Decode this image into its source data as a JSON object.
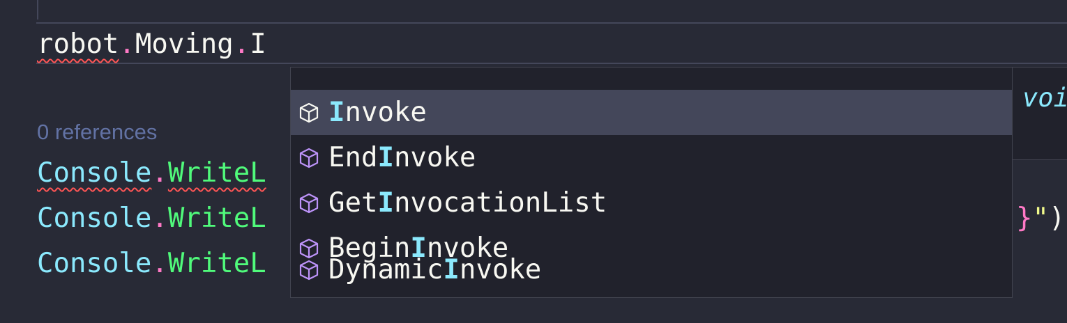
{
  "editor": {
    "active_line": {
      "segments": [
        "robot",
        ".",
        "Moving",
        ".",
        "I"
      ]
    },
    "codelens": "0 references",
    "lines": [
      {
        "object": "Console",
        "dot": ".",
        "method": "WriteL"
      },
      {
        "object": "Console",
        "dot": ".",
        "method": "WriteL"
      },
      {
        "object": "Console",
        "dot": ".",
        "method": "WriteL"
      }
    ],
    "right_tail": {
      "brace": "}",
      "quote": "\"",
      "paren": ")"
    }
  },
  "suggest_widget": {
    "items": [
      {
        "prefix": "",
        "match": "I",
        "suffix": "nvoke",
        "icon": "method-cube-icon",
        "selected": true
      },
      {
        "prefix": "End",
        "match": "I",
        "suffix": "nvoke",
        "icon": "method-cube-icon",
        "selected": false
      },
      {
        "prefix": "Get",
        "match": "I",
        "suffix": "nvocationList",
        "icon": "method-cube-icon",
        "selected": false
      },
      {
        "prefix": "Begin",
        "match": "I",
        "suffix": "nvoke",
        "icon": "method-cube-icon",
        "selected": false
      },
      {
        "prefix": "Dynamic",
        "match": "I",
        "suffix": "nvoke",
        "icon": "method-cube-icon",
        "selected": false
      }
    ]
  },
  "details": {
    "signature_fragment": "voi"
  },
  "colors": {
    "background": "#282a36",
    "keyword_pink": "#ff79c6",
    "type_cyan": "#8be9fd",
    "method_green": "#50fa7b",
    "string_yellow": "#f1fa8c",
    "error_squiggle": "#ff5555",
    "method_icon_purple": "#bd93f9"
  }
}
